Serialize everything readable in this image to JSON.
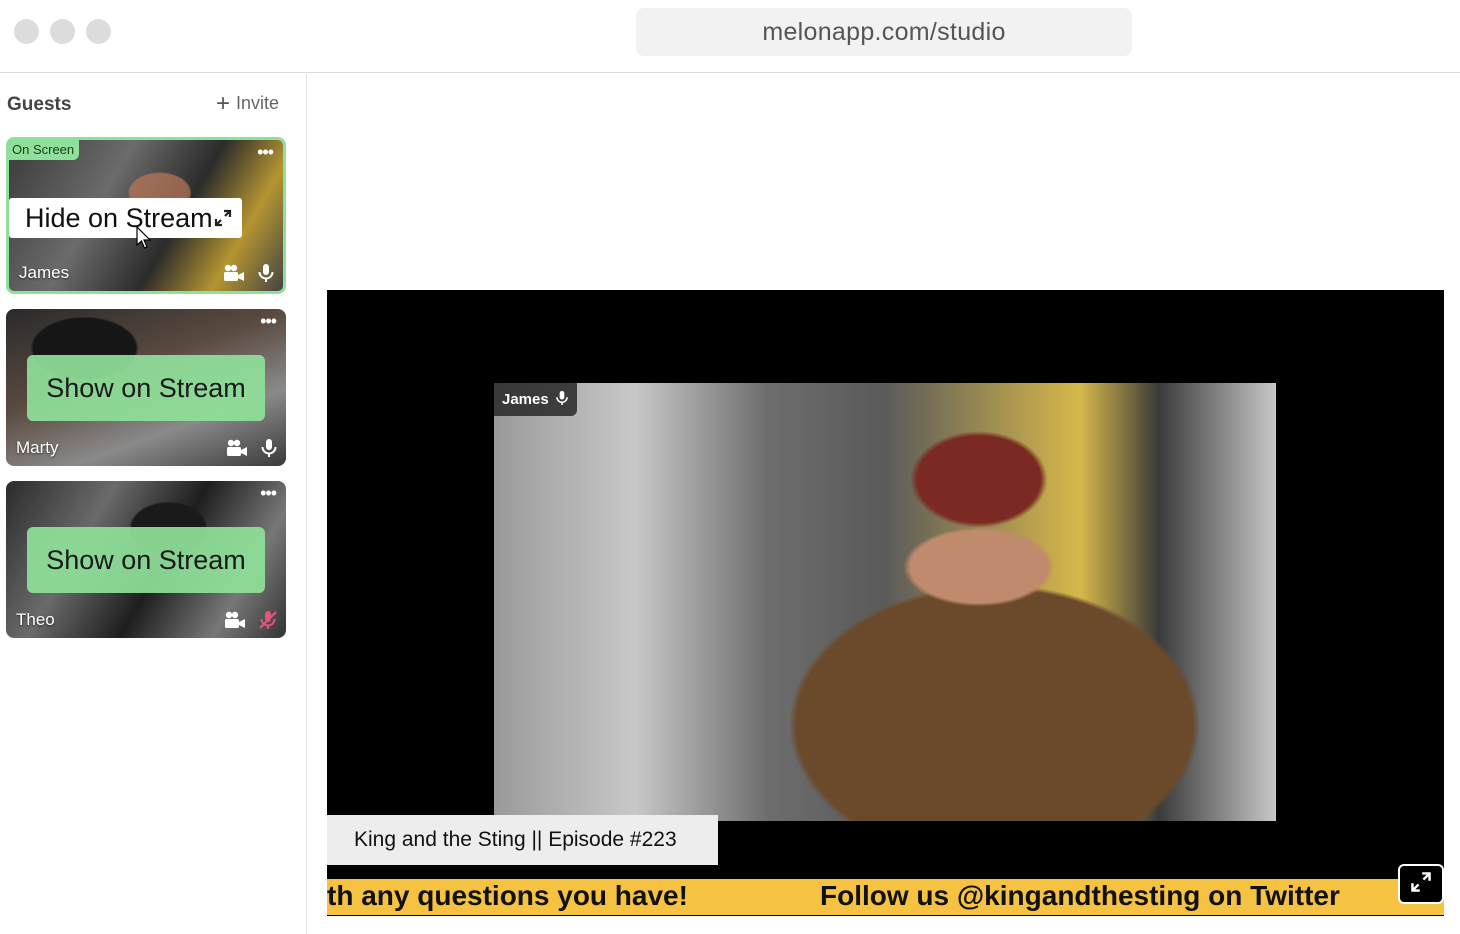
{
  "browser": {
    "url": "melonapp.com/studio"
  },
  "sidebar": {
    "title": "Guests",
    "invite_label": "Invite",
    "guests": [
      {
        "name": "James",
        "status": "On Screen",
        "action_label": "Hide on Stream",
        "mic": "on"
      },
      {
        "name": "Marty",
        "action_label": "Show on Stream",
        "mic": "on"
      },
      {
        "name": "Theo",
        "action_label": "Show on Stream",
        "mic": "muted"
      }
    ]
  },
  "stage": {
    "video_label": "James",
    "lower_third": "King and the Sting || Episode #223",
    "ticker": [
      "th any questions you have!",
      "Follow us @kingandthesting on Twitter"
    ]
  },
  "colors": {
    "accent_green": "#8fe09a",
    "ticker_yellow": "#f5c242",
    "muted_mic": "#e0557a"
  }
}
